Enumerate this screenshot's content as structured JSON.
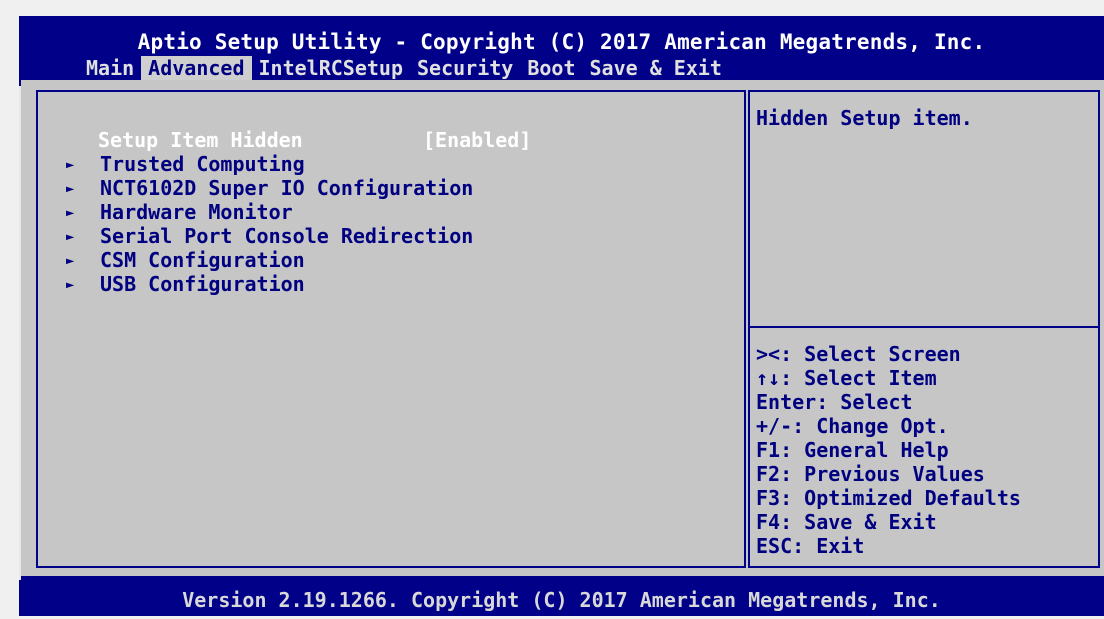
{
  "header": {
    "title": "Aptio Setup Utility - Copyright (C) 2017 American Megatrends, Inc."
  },
  "tabs": [
    {
      "label": "Main"
    },
    {
      "label": "Advanced"
    },
    {
      "label": "IntelRCSetup"
    },
    {
      "label": "Security"
    },
    {
      "label": "Boot"
    },
    {
      "label": "Save & Exit"
    }
  ],
  "active_tab": "Advanced",
  "settings": {
    "setup_item_hidden": {
      "label": "Setup Item Hidden",
      "value": "[Enabled]"
    }
  },
  "submenus": [
    {
      "label": "Trusted Computing",
      "icon": "right-triangle"
    },
    {
      "label": "NCT6102D Super IO Configuration",
      "icon": "right-triangle"
    },
    {
      "label": "Hardware Monitor",
      "icon": "right-triangle"
    },
    {
      "label": "Serial Port Console Redirection",
      "icon": "right-triangle"
    },
    {
      "label": "CSM Configuration",
      "icon": "right-triangle"
    },
    {
      "label": "USB Configuration",
      "icon": "right-triangle"
    }
  ],
  "help": {
    "text": "Hidden Setup item."
  },
  "keys": [
    "><: Select Screen",
    "↑↓: Select Item",
    "Enter: Select",
    "+/-: Change Opt.",
    "F1: General Help",
    "F2: Previous Values",
    "F3: Optimized Defaults",
    "F4: Save & Exit",
    "ESC: Exit"
  ],
  "footer": {
    "text": "Version 2.19.1266. Copyright (C) 2017 American Megatrends, Inc."
  },
  "colors": {
    "frame_blue": "#000088",
    "body_gray": "#c6c6c6",
    "text_blue": "#000080",
    "highlight_white": "#ffffff"
  }
}
